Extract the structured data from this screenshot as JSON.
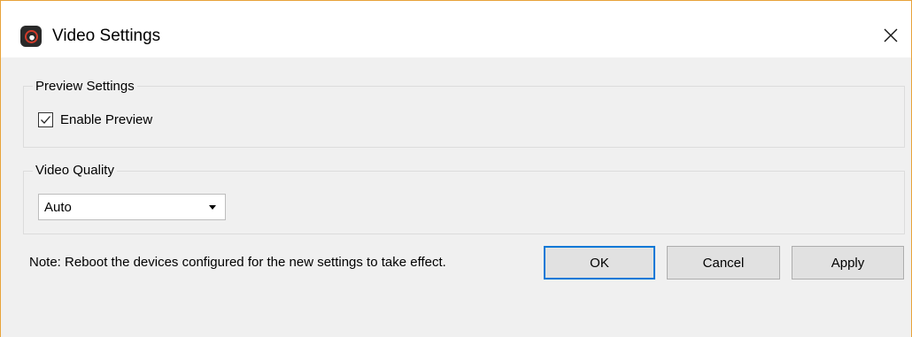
{
  "window": {
    "title": "Video Settings",
    "app_icon": "app-logo-icon",
    "close_icon": "close-icon"
  },
  "preview_settings": {
    "legend": "Preview Settings",
    "enable_preview": {
      "label": "Enable Preview",
      "checked": true
    }
  },
  "video_quality": {
    "legend": "Video Quality",
    "selected": "Auto"
  },
  "footer": {
    "note": "Note: Reboot the devices configured for the new settings to take effect.",
    "ok_label": "OK",
    "cancel_label": "Cancel",
    "apply_label": "Apply"
  },
  "colors": {
    "accent": "#0078d7",
    "window_border": "#e8a33a",
    "dialog_bg": "#f0f0f0"
  }
}
